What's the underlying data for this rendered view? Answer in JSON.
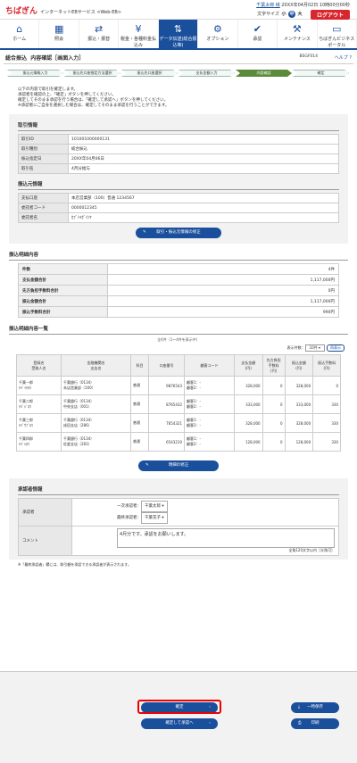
{
  "header": {
    "logo": "ちばぎん",
    "service": "インターネットEBサービス <Web-EB>",
    "user": "千葉太郎 様",
    "login_info": "20XX年04月02日 10時00分00秒",
    "fontsize_label": "文字サイズ",
    "font_small": "小",
    "font_mid": "中",
    "font_large": "大",
    "logout": "ログアウト"
  },
  "nav": [
    {
      "label": "ホーム",
      "icon": "⌂"
    },
    {
      "label": "照会",
      "icon": "▦"
    },
    {
      "label": "振込・振替",
      "icon": "⇄"
    },
    {
      "label": "税金・各種料金払込み",
      "icon": "¥"
    },
    {
      "label": "データ伝送(総合振込等)",
      "icon": "⇅"
    },
    {
      "label": "オプション",
      "icon": "⚙"
    },
    {
      "label": "承認",
      "icon": "✔"
    },
    {
      "label": "メンテナンス",
      "icon": "⚒"
    },
    {
      "label": "ちばぎんビジネスポータル",
      "icon": "▭"
    }
  ],
  "page": {
    "category": "総合振込",
    "title": "内容確認［画面入力］",
    "screen_id": "BSGF014",
    "help": "ヘルプ"
  },
  "steps": [
    "振込元情報入力",
    "振込先口座指定方法選択",
    "振込先口座選択",
    "支払金額入力",
    "内容確認",
    "確定"
  ],
  "message": [
    "以下の内容で取引を確定します。",
    "承認者を確認の上、「確定」ボタンを押してください。",
    "確定してそのまま承認を行う場合は、「確定して承認へ」ボタンを押してください。",
    "※承認者にご自身を選択した場合は、確定してそのまま承認を行うことができます。"
  ],
  "trade": {
    "heading": "取引情報",
    "rows": [
      {
        "k": "取引ID",
        "v": "101001000000131"
      },
      {
        "k": "取引種別",
        "v": "総合振込"
      },
      {
        "k": "振込指定日",
        "v": "20XX年04月06日"
      },
      {
        "k": "取引名",
        "v": "4月分給与"
      }
    ]
  },
  "source": {
    "heading": "振込元情報",
    "rows": [
      {
        "k": "支払口座",
        "v": "本店営業部（100）普通 1234567"
      },
      {
        "k": "委託者コード",
        "v": "0000012345"
      },
      {
        "k": "委託者名",
        "v": "ｶﾌﾞｼｷｶﾞｲｼﾔ"
      }
    ],
    "edit_button": "取引・振込元情報の修正"
  },
  "summary": {
    "heading": "振込明細内容",
    "rows": [
      {
        "k": "件数",
        "v": "4件"
      },
      {
        "k": "支払金額合計",
        "v": "1,117,000円"
      },
      {
        "k": "先方負担手数料合計",
        "v": "0円"
      },
      {
        "k": "振込金額合計",
        "v": "1,117,000円"
      },
      {
        "k": "振込手数料合計",
        "v": "990円"
      }
    ]
  },
  "list": {
    "heading": "振込明細内容一覧",
    "count": "全4件（1～4件を表示中）",
    "display_label": "表示件数：",
    "display_value": "10件",
    "redisplay": "再表示",
    "columns": [
      "登録名\n受取人名",
      "金融機関名\n支店名",
      "科目",
      "口座番号",
      "顧客コード",
      "支払金額\n(円)",
      "先方負担\n手数料\n(円)",
      "振込金額\n(円)",
      "振込手数料\n(円)"
    ],
    "rows": [
      [
        "千葉一郎\nﾁﾊﾞｲﾁﾛｳ",
        "千葉銀行（0134）\n本店営業部（100）",
        "普通",
        "9876543",
        "顧客1：-\n顧客2：-",
        "328,000",
        "0",
        "328,000",
        "0"
      ],
      [
        "千葉二郎\nﾁﾊﾞｼﾞﾛｳ",
        "千葉銀行（0134）\n中央支店（001）",
        "普通",
        "8765432",
        "顧客1：-\n顧客2：-",
        "333,000",
        "0",
        "333,000",
        "330"
      ],
      [
        "千葉三郎\nﾁﾊﾞｻﾌﾞﾛｳ",
        "千葉銀行（0134）\n成田支店（286）",
        "普通",
        "7654321",
        "顧客1：-\n顧客2：-",
        "328,000",
        "0",
        "328,000",
        "330"
      ],
      [
        "千葉四郎\nﾁﾊﾞｼﾛｳ",
        "千葉銀行（0134）\n佐倉支店（283）",
        "普通",
        "6543210",
        "顧客1：-\n顧客2：-",
        "128,000",
        "0",
        "128,000",
        "330"
      ]
    ],
    "edit_button": "明細の修正"
  },
  "approver": {
    "heading": "承認者情報",
    "k1": "承認者",
    "first_label": "一次承認者：",
    "first_value": "千葉太郎",
    "final_label": "最終承認者：",
    "final_value": "千葉花子",
    "k2": "コメント",
    "comment": "4月分です。承認をお願いします。",
    "limit": "全角120文字以内［半角可］",
    "note": "※「最終承認者」欄には、取引額を承認できる承認者が表示されます。"
  },
  "footer": {
    "confirm": "確定",
    "confirm_approve": "確定して承認へ",
    "temp_save": "一時保存",
    "print": "印刷"
  }
}
